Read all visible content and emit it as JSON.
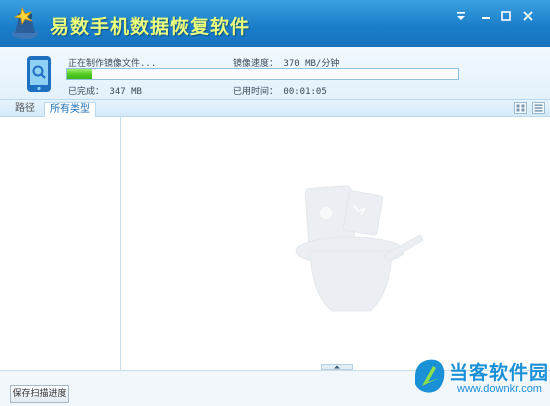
{
  "window": {
    "title": "易数手机数据恢复软件",
    "controls": [
      "menu-icon",
      "minimize-icon",
      "maximize-icon",
      "close-icon"
    ]
  },
  "progress": {
    "status_text": "正在制作镜像文件...",
    "speed_text": "镜像速度： 370 MB/分钟",
    "completed_text": "已完成： 347 MB",
    "elapsed_text": "已用时间： 00:01:05",
    "fraction": 0.065
  },
  "tabs": [
    {
      "label": "路径",
      "active": false
    },
    {
      "label": "所有类型",
      "active": true
    }
  ],
  "view_buttons": [
    "grid-view-icon",
    "list-view-icon"
  ],
  "bottom": {
    "save_button_label": "保存扫描进度"
  },
  "watermark_badge": {
    "name": "当客软件园",
    "url": "www.downkr.com"
  },
  "colors": {
    "titlebar": "#1a7dc8",
    "title_text": "#eaff7a",
    "progress_fill": "#4ec81f",
    "panel_border": "#b9d9ef",
    "brand": "#1a90d6"
  }
}
